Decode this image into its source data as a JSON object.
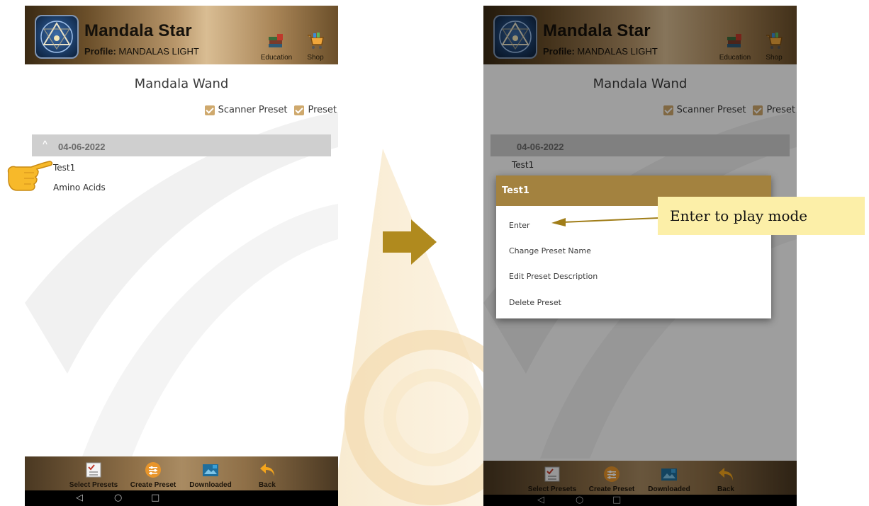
{
  "app": {
    "title": "Mandala Star",
    "profile_label": "Profile:",
    "profile_name": "MANDALAS LIGHT"
  },
  "top_actions": [
    {
      "label": "Education",
      "icon": "book-stack-icon"
    },
    {
      "label": "Shop",
      "icon": "shopping-cart-icon"
    }
  ],
  "screen": {
    "title": "Mandala Wand",
    "filters": [
      {
        "label": "Scanner Preset",
        "checked": true
      },
      {
        "label": "Preset",
        "checked": true
      }
    ],
    "group_date": "04-06-2022",
    "items": [
      "Test1",
      "Amino Acids"
    ]
  },
  "bottom_nav": [
    {
      "label": "Select Presets",
      "icon": "checklist-icon"
    },
    {
      "label": "Create Preset",
      "icon": "sliders-circle-icon"
    },
    {
      "label": "Downloaded",
      "icon": "download-image-icon"
    },
    {
      "label": "Back",
      "icon": "back-arrow-icon"
    }
  ],
  "system_nav": {
    "back": "◁",
    "home": "○",
    "recents": "□"
  },
  "dialog": {
    "title": "Test1",
    "options": [
      "Enter",
      "Change Preset Name",
      "Edit Preset Description",
      "Delete Preset"
    ]
  },
  "annotation": {
    "callout_text": "Enter to play mode"
  },
  "colors": {
    "accent_gold": "#a3823f",
    "checkbox": "#cfa96d",
    "callout_bg": "#fcefa8",
    "arrow": "#b08a1e"
  }
}
